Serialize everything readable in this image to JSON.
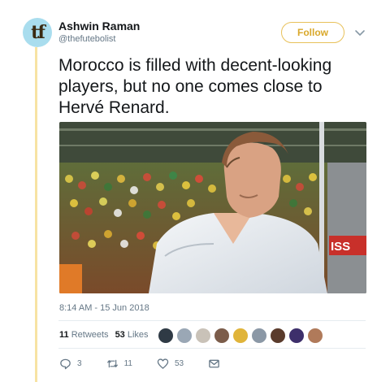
{
  "author": {
    "avatar_text": "tf",
    "name": "Ashwin Raman",
    "handle": "@thefutebolist"
  },
  "follow_label": "Follow",
  "tweet": {
    "text": "Morocco is filled with decent-looking players, but no one comes close to Hervé Renard.",
    "image_signage": "ISS",
    "timestamp": "8:14 AM - 15 Jun 2018"
  },
  "stats": {
    "retweets_count": "11",
    "retweets_label": "Retweets",
    "likes_count": "53",
    "likes_label": "Likes"
  },
  "actions": {
    "reply_count": "3",
    "retweet_count": "11",
    "like_count": "53"
  },
  "likers": [
    "#2f3a45",
    "#9aa7b5",
    "#c9c2b8",
    "#7b5c4a",
    "#e0b43a",
    "#8b98a6",
    "#5a3b2c",
    "#3d2f6b",
    "#b07a5a"
  ],
  "colors": {
    "accent": "#d9a82a",
    "thread_line": "#f7e3a3",
    "avatar_bg": "#a9ddee"
  }
}
